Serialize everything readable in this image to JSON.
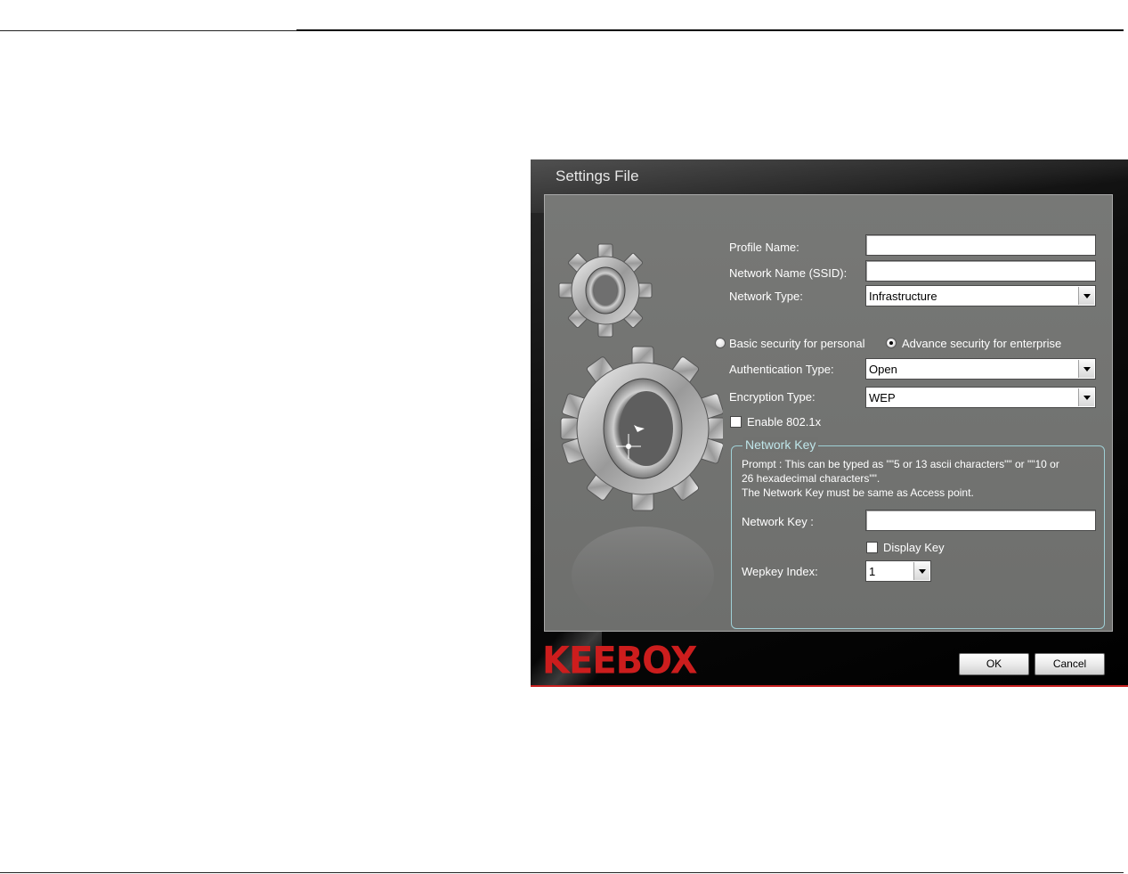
{
  "window": {
    "title": "Settings File"
  },
  "form": {
    "profile_name": {
      "label": "Profile Name:",
      "value": ""
    },
    "ssid": {
      "label": "Network Name (SSID):",
      "value": ""
    },
    "network_type": {
      "label": "Network Type:",
      "selected": "Infrastructure"
    },
    "security_mode": {
      "options": [
        {
          "label": "Basic security for personal",
          "checked": false
        },
        {
          "label": "Advance security for enterprise",
          "checked": true
        }
      ]
    },
    "auth_type": {
      "label": "Authentication Type:",
      "selected": "Open"
    },
    "encryption_type": {
      "label": "Encryption Type:",
      "selected": "WEP"
    },
    "enable_8021x": {
      "label": "Enable 802.1x",
      "checked": false
    }
  },
  "network_key_group": {
    "legend": "Network Key",
    "prompt_lines": [
      "Prompt : This can be typed as \"\"5 or 13 ascii characters\"\" or \"\"10 or",
      "26 hexadecimal characters\"\".",
      "The Network Key must be same as Access point."
    ],
    "network_key": {
      "label": "Network Key :",
      "value": ""
    },
    "display_key": {
      "label": "Display Key",
      "checked": false
    },
    "wepkey_index": {
      "label": "Wepkey Index:",
      "selected": "1"
    }
  },
  "footer": {
    "brand": "KEEBOX",
    "ok_label": "OK",
    "cancel_label": "Cancel"
  },
  "colors": {
    "brand_red": "#cc1d1d",
    "panel_gray": "#717270",
    "group_border": "#9fd0d6"
  }
}
